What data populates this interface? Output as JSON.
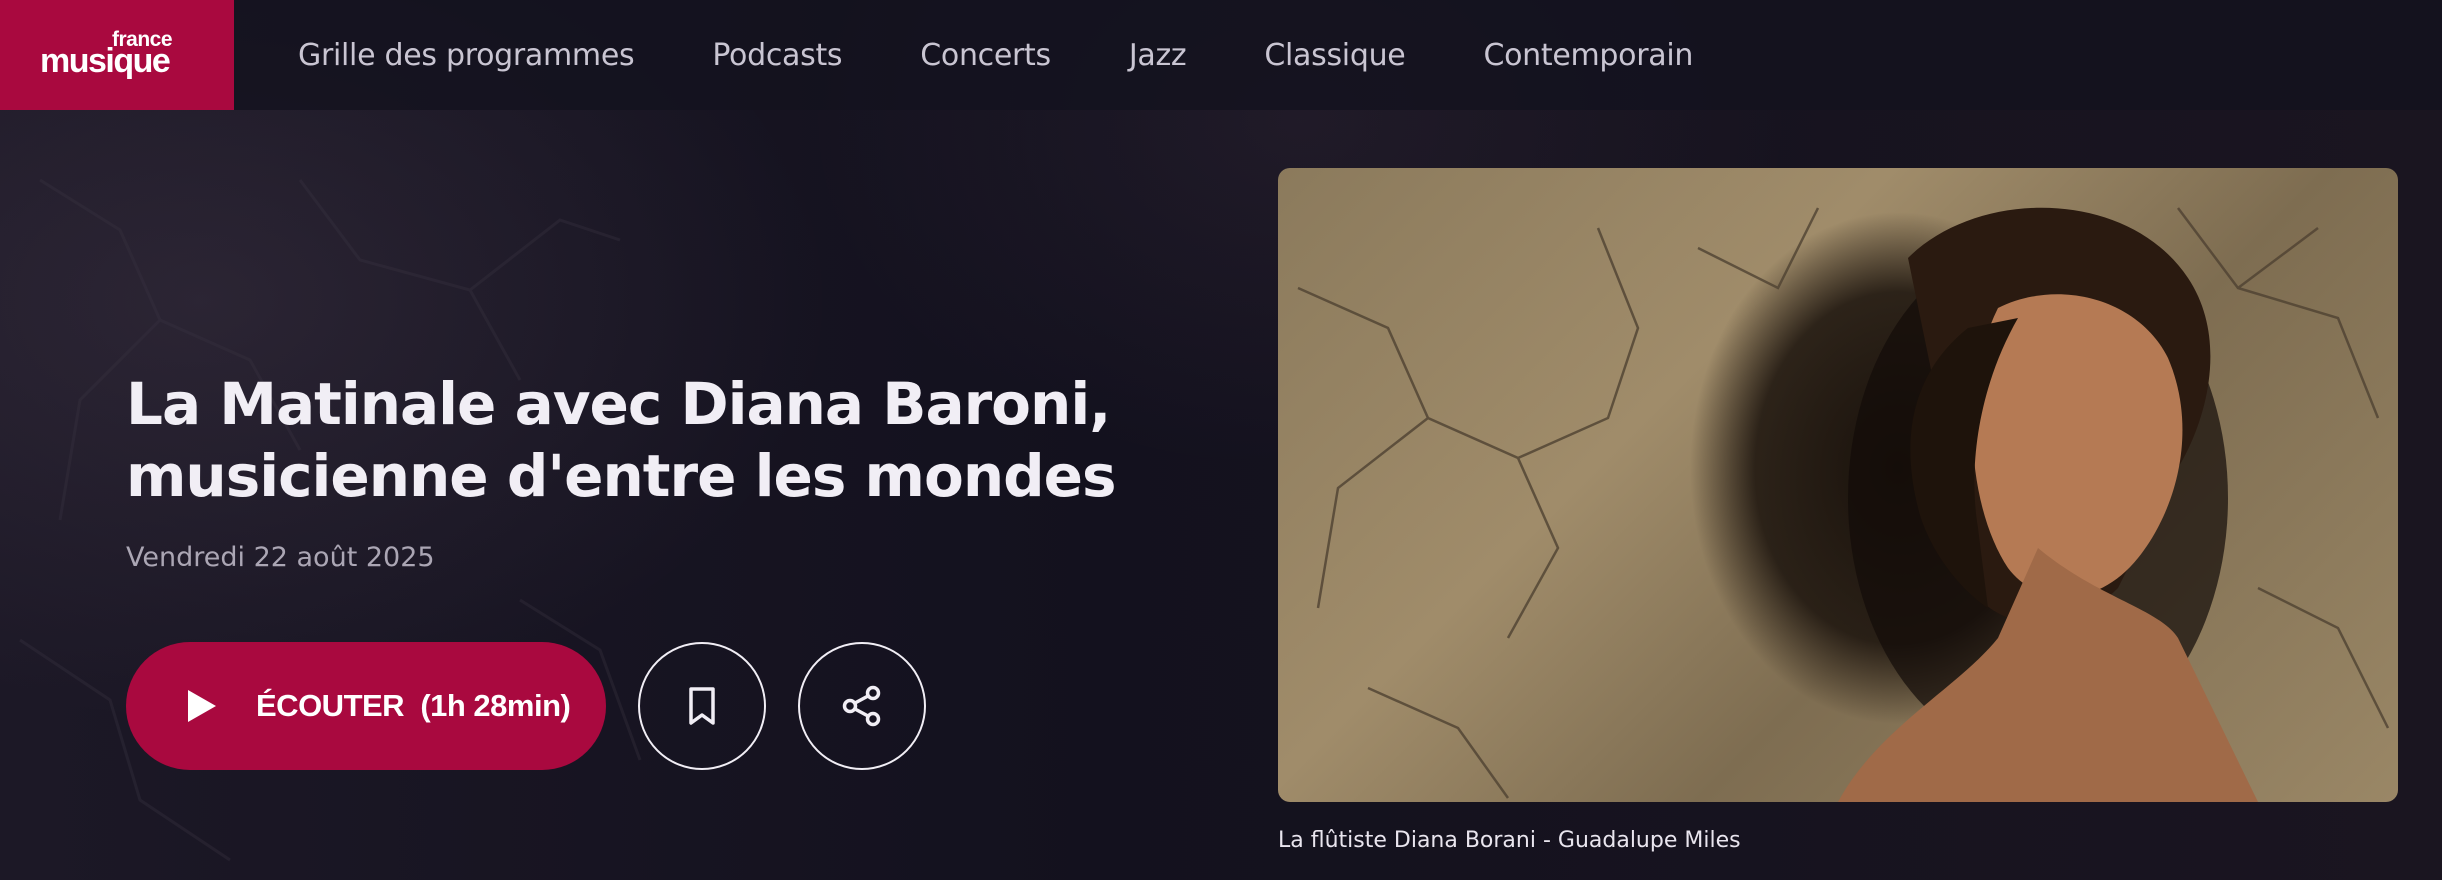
{
  "brand": {
    "line1": "france",
    "line2": "musique",
    "color": "#a9093f"
  },
  "nav": {
    "items": [
      {
        "label": "Grille des programmes"
      },
      {
        "label": "Podcasts"
      },
      {
        "label": "Concerts"
      },
      {
        "label": "Jazz"
      },
      {
        "label": "Classique"
      },
      {
        "label": "Contemporain"
      }
    ]
  },
  "episode": {
    "title_line1": "La Matinale avec Diana Baroni,",
    "title_line2": "musicienne d'entre les mondes",
    "date": "Vendredi 22 août 2025",
    "listen_label": "ÉCOUTER",
    "duration": "(1h 28min)",
    "image_caption": "La flûtiste Diana Borani - Guadalupe Miles"
  },
  "icons": {
    "play": "play-icon",
    "bookmark": "bookmark-icon",
    "share": "share-icon"
  },
  "colors": {
    "background": "#13111e",
    "accent": "#a9093f",
    "text": "#f1eef5",
    "muted": "#aba6b4"
  }
}
